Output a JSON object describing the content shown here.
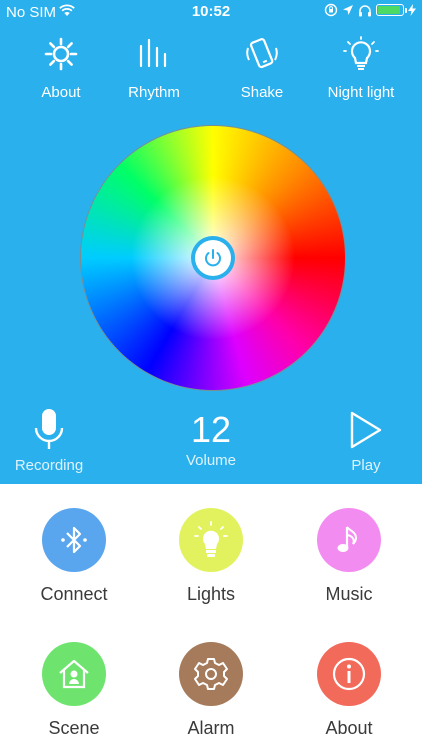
{
  "status_bar": {
    "carrier": "No SIM",
    "time": "10:52",
    "battery_level": 0.95,
    "battery_color": "#4cd964"
  },
  "top_menu": [
    {
      "label": "About",
      "icon": "sun-gear-icon"
    },
    {
      "label": "Rhythm",
      "icon": "rhythm-bars-icon"
    },
    {
      "label": "Shake",
      "icon": "shake-phone-icon"
    },
    {
      "label": "Night light",
      "icon": "lightbulb-icon"
    }
  ],
  "controls": {
    "recording_label": "Recording",
    "volume_value": "12",
    "volume_label": "Volume",
    "play_label": "Play"
  },
  "features": [
    {
      "label": "Connect",
      "icon": "bluetooth-icon",
      "color": "#5aa6ee"
    },
    {
      "label": "Lights",
      "icon": "lightbulb-icon",
      "color": "#e2f25e"
    },
    {
      "label": "Music",
      "icon": "music-note-icon",
      "color": "#f38cf0"
    },
    {
      "label": "Scene",
      "icon": "house-icon",
      "color": "#6ee46f"
    },
    {
      "label": "Alarm",
      "icon": "gear-icon",
      "color": "#a67b5b"
    },
    {
      "label": "About",
      "icon": "info-icon",
      "color": "#f26a5a"
    }
  ],
  "colors": {
    "primary_blue": "#2ab0ec",
    "background": "#ffffff",
    "label_text": "#3a3a3a"
  }
}
